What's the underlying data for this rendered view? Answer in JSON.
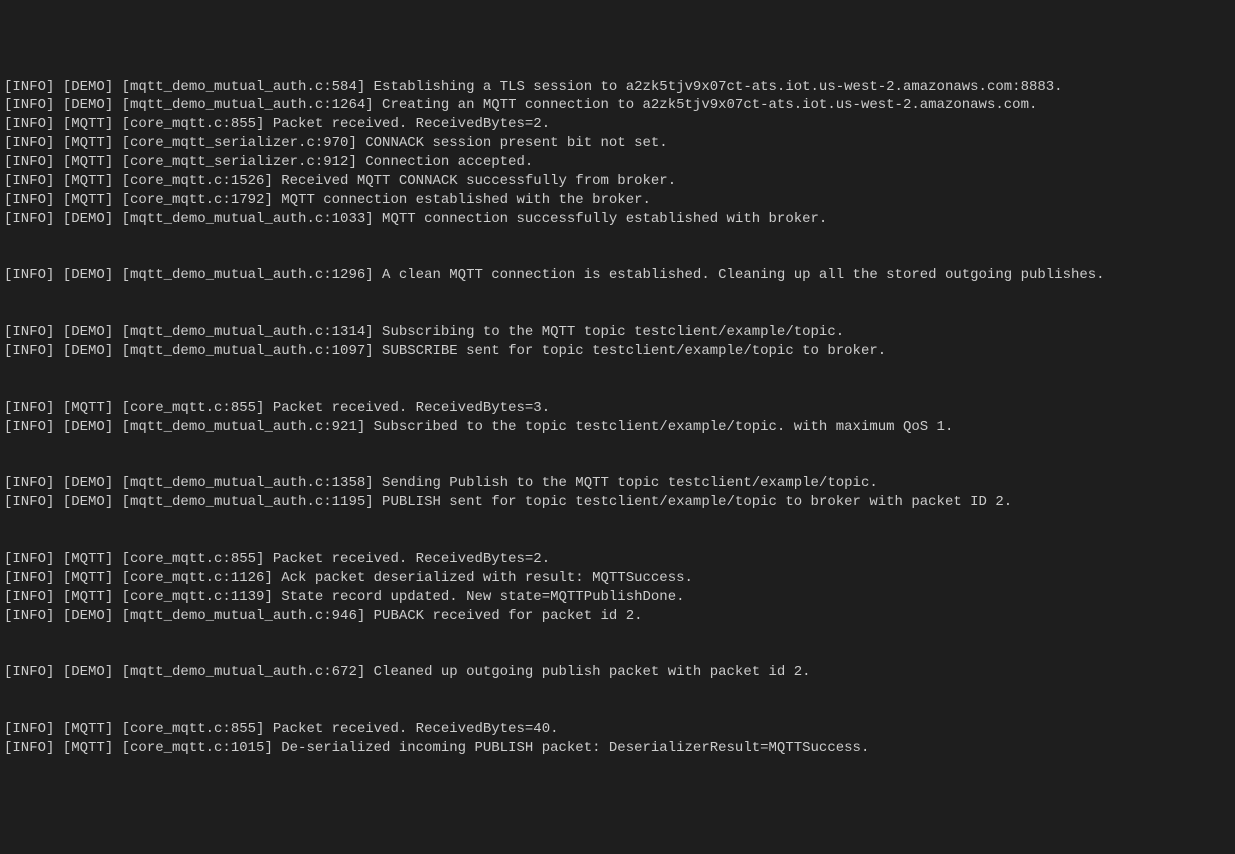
{
  "log_lines": [
    {
      "type": "text",
      "level": "[INFO]",
      "tag": "[DEMO]",
      "loc": "[mqtt_demo_mutual_auth.c:584]",
      "msg": "Establishing a TLS session to a2zk5tjv9x07ct-ats.iot.us-west-2.amazonaws.com:8883."
    },
    {
      "type": "text",
      "level": "[INFO]",
      "tag": "[DEMO]",
      "loc": "[mqtt_demo_mutual_auth.c:1264]",
      "msg": "Creating an MQTT connection to a2zk5tjv9x07ct-ats.iot.us-west-2.amazonaws.com."
    },
    {
      "type": "text",
      "level": "[INFO]",
      "tag": "[MQTT]",
      "loc": "[core_mqtt.c:855]",
      "msg": "Packet received. ReceivedBytes=2."
    },
    {
      "type": "text",
      "level": "[INFO]",
      "tag": "[MQTT]",
      "loc": "[core_mqtt_serializer.c:970]",
      "msg": "CONNACK session present bit not set."
    },
    {
      "type": "text",
      "level": "[INFO]",
      "tag": "[MQTT]",
      "loc": "[core_mqtt_serializer.c:912]",
      "msg": "Connection accepted."
    },
    {
      "type": "text",
      "level": "[INFO]",
      "tag": "[MQTT]",
      "loc": "[core_mqtt.c:1526]",
      "msg": "Received MQTT CONNACK successfully from broker."
    },
    {
      "type": "text",
      "level": "[INFO]",
      "tag": "[MQTT]",
      "loc": "[core_mqtt.c:1792]",
      "msg": "MQTT connection established with the broker."
    },
    {
      "type": "text",
      "level": "[INFO]",
      "tag": "[DEMO]",
      "loc": "[mqtt_demo_mutual_auth.c:1033]",
      "msg": "MQTT connection successfully established with broker."
    },
    {
      "type": "blank"
    },
    {
      "type": "blank"
    },
    {
      "type": "text",
      "level": "[INFO]",
      "tag": "[DEMO]",
      "loc": "[mqtt_demo_mutual_auth.c:1296]",
      "msg": "A clean MQTT connection is established. Cleaning up all the stored outgoing publishes."
    },
    {
      "type": "blank"
    },
    {
      "type": "blank"
    },
    {
      "type": "text",
      "level": "[INFO]",
      "tag": "[DEMO]",
      "loc": "[mqtt_demo_mutual_auth.c:1314]",
      "msg": "Subscribing to the MQTT topic testclient/example/topic."
    },
    {
      "type": "text",
      "level": "[INFO]",
      "tag": "[DEMO]",
      "loc": "[mqtt_demo_mutual_auth.c:1097]",
      "msg": "SUBSCRIBE sent for topic testclient/example/topic to broker."
    },
    {
      "type": "blank"
    },
    {
      "type": "blank"
    },
    {
      "type": "text",
      "level": "[INFO]",
      "tag": "[MQTT]",
      "loc": "[core_mqtt.c:855]",
      "msg": "Packet received. ReceivedBytes=3."
    },
    {
      "type": "text",
      "level": "[INFO]",
      "tag": "[DEMO]",
      "loc": "[mqtt_demo_mutual_auth.c:921]",
      "msg": "Subscribed to the topic testclient/example/topic. with maximum QoS 1."
    },
    {
      "type": "blank"
    },
    {
      "type": "blank"
    },
    {
      "type": "text",
      "level": "[INFO]",
      "tag": "[DEMO]",
      "loc": "[mqtt_demo_mutual_auth.c:1358]",
      "msg": "Sending Publish to the MQTT topic testclient/example/topic."
    },
    {
      "type": "text",
      "level": "[INFO]",
      "tag": "[DEMO]",
      "loc": "[mqtt_demo_mutual_auth.c:1195]",
      "msg": "PUBLISH sent for topic testclient/example/topic to broker with packet ID 2."
    },
    {
      "type": "blank"
    },
    {
      "type": "blank"
    },
    {
      "type": "text",
      "level": "[INFO]",
      "tag": "[MQTT]",
      "loc": "[core_mqtt.c:855]",
      "msg": "Packet received. ReceivedBytes=2."
    },
    {
      "type": "text",
      "level": "[INFO]",
      "tag": "[MQTT]",
      "loc": "[core_mqtt.c:1126]",
      "msg": "Ack packet deserialized with result: MQTTSuccess."
    },
    {
      "type": "text",
      "level": "[INFO]",
      "tag": "[MQTT]",
      "loc": "[core_mqtt.c:1139]",
      "msg": "State record updated. New state=MQTTPublishDone."
    },
    {
      "type": "text",
      "level": "[INFO]",
      "tag": "[DEMO]",
      "loc": "[mqtt_demo_mutual_auth.c:946]",
      "msg": "PUBACK received for packet id 2."
    },
    {
      "type": "blank"
    },
    {
      "type": "blank"
    },
    {
      "type": "text",
      "level": "[INFO]",
      "tag": "[DEMO]",
      "loc": "[mqtt_demo_mutual_auth.c:672]",
      "msg": "Cleaned up outgoing publish packet with packet id 2."
    },
    {
      "type": "blank"
    },
    {
      "type": "blank"
    },
    {
      "type": "text",
      "level": "[INFO]",
      "tag": "[MQTT]",
      "loc": "[core_mqtt.c:855]",
      "msg": "Packet received. ReceivedBytes=40."
    },
    {
      "type": "text",
      "level": "[INFO]",
      "tag": "[MQTT]",
      "loc": "[core_mqtt.c:1015]",
      "msg": "De-serialized incoming PUBLISH packet: DeserializerResult=MQTTSuccess."
    }
  ]
}
